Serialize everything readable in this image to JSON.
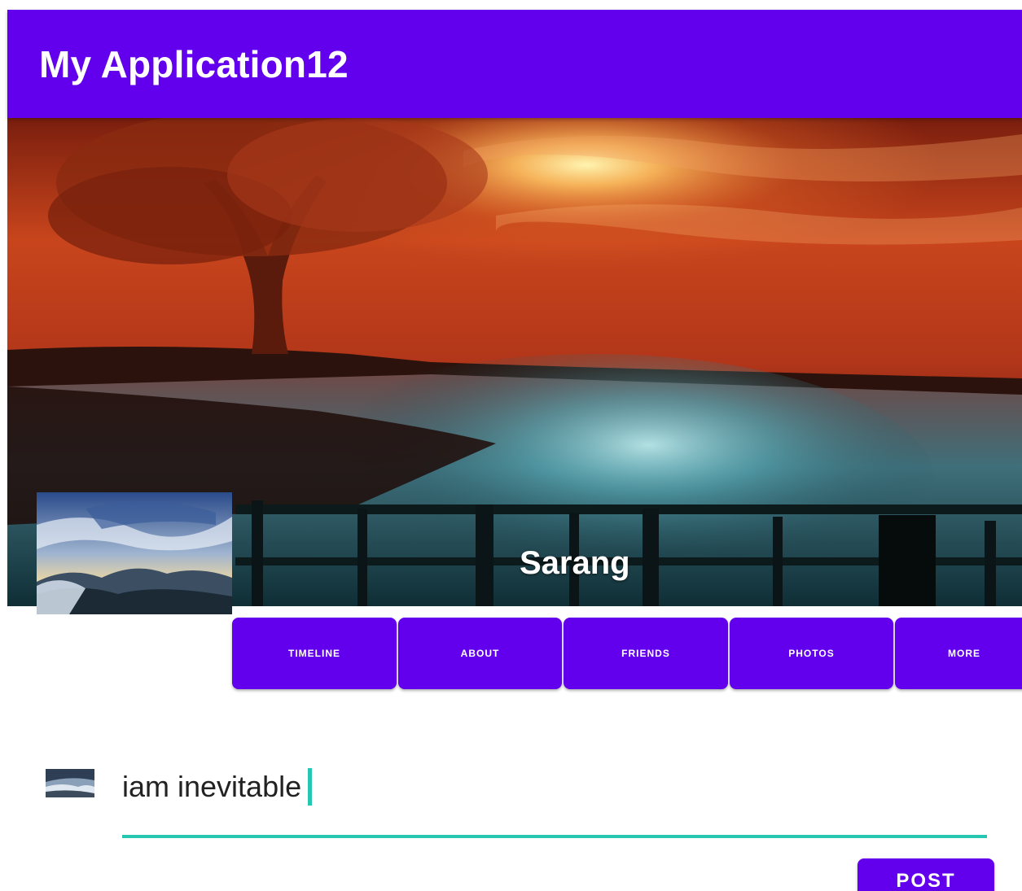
{
  "app": {
    "title": "My Application12"
  },
  "profile": {
    "name": "Sarang"
  },
  "tabs": [
    {
      "label": "TIMELINE"
    },
    {
      "label": "ABOUT"
    },
    {
      "label": "FRIENDS"
    },
    {
      "label": "PHOTOS"
    },
    {
      "label": "MORE"
    }
  ],
  "composer": {
    "value": "iam inevitable",
    "post_label": "POST"
  },
  "colors": {
    "primary": "#6200ee",
    "accent": "#26c6b1",
    "on_primary": "#ffffff"
  }
}
